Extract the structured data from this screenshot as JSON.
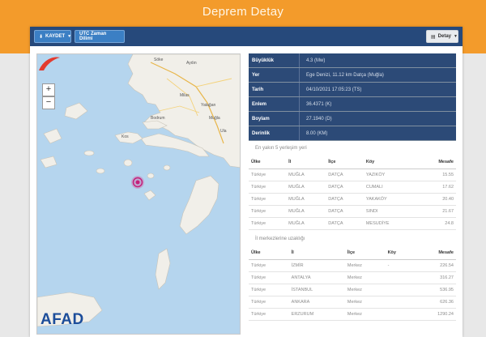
{
  "page": {
    "title": "Deprem Detay"
  },
  "toolbar": {
    "save_label": "KAYDET",
    "utc_label": "UTC Zaman Dilimi",
    "detail_label": "Detay"
  },
  "map": {
    "zoom_in": "+",
    "zoom_out": "−",
    "logo": "AFAD"
  },
  "info": [
    {
      "key": "Büyüklük",
      "value": "4.3 (Mw)"
    },
    {
      "key": "Yer",
      "value": "Ege Denizi, 11.12 km Datça (Muğla)"
    },
    {
      "key": "Tarih",
      "value": "04/10/2021 17:05:23 (TS)"
    },
    {
      "key": "Enlem",
      "value": "36.4371 (K)"
    },
    {
      "key": "Boylam",
      "value": "27.1940 (D)"
    },
    {
      "key": "Derinlik",
      "value": "8.00 (KM)"
    }
  ],
  "near": {
    "title": "En yakın 5 yerleşim yeri",
    "headers": {
      "country": "Ülke",
      "province": "İl",
      "district": "İlçe",
      "village": "Köy",
      "distance": "Mesafe"
    },
    "rows": [
      {
        "country": "Türkiye",
        "province": "MUĞLA",
        "district": "DATÇA",
        "village": "YAZIKÖY",
        "distance": "15.55"
      },
      {
        "country": "Türkiye",
        "province": "MUĞLA",
        "district": "DATÇA",
        "village": "CUMALI",
        "distance": "17.62"
      },
      {
        "country": "Türkiye",
        "province": "MUĞLA",
        "district": "DATÇA",
        "village": "YAKAKÖY",
        "distance": "20.40"
      },
      {
        "country": "Türkiye",
        "province": "MUĞLA",
        "district": "DATÇA",
        "village": "SINDI",
        "distance": "21.67"
      },
      {
        "country": "Türkiye",
        "province": "MUĞLA",
        "district": "DATÇA",
        "village": "MESUDİYE",
        "distance": "24.8"
      }
    ]
  },
  "far": {
    "title": "İl merkezlerine uzaklığı",
    "headers": {
      "country": "Ülke",
      "province": "İl",
      "district": "İlçe",
      "village": "Köy",
      "distance": "Mesafe"
    },
    "rows": [
      {
        "country": "Türkiye",
        "province": "İZMİR",
        "district": "Merkez",
        "village": "-",
        "distance": "226.54"
      },
      {
        "country": "Türkiye",
        "province": "ANTALYA",
        "district": "Merkez",
        "village": "",
        "distance": "316.27"
      },
      {
        "country": "Türkiye",
        "province": "İSTANBUL",
        "district": "Merkez",
        "village": "",
        "distance": "536.95"
      },
      {
        "country": "Türkiye",
        "province": "ANKARA",
        "district": "Merkez",
        "village": "",
        "distance": "626.36"
      },
      {
        "country": "Türkiye",
        "province": "ERZURUM",
        "district": "Merkez",
        "village": "",
        "distance": "1290.24"
      }
    ]
  },
  "map_labels": [
    {
      "text": "Söke"
    },
    {
      "text": "Aydın"
    },
    {
      "text": "Milas"
    },
    {
      "text": "Muğla"
    },
    {
      "text": "Bodrum"
    },
    {
      "text": "Yatağan"
    },
    {
      "text": "Kos"
    },
    {
      "text": "Ula"
    }
  ]
}
